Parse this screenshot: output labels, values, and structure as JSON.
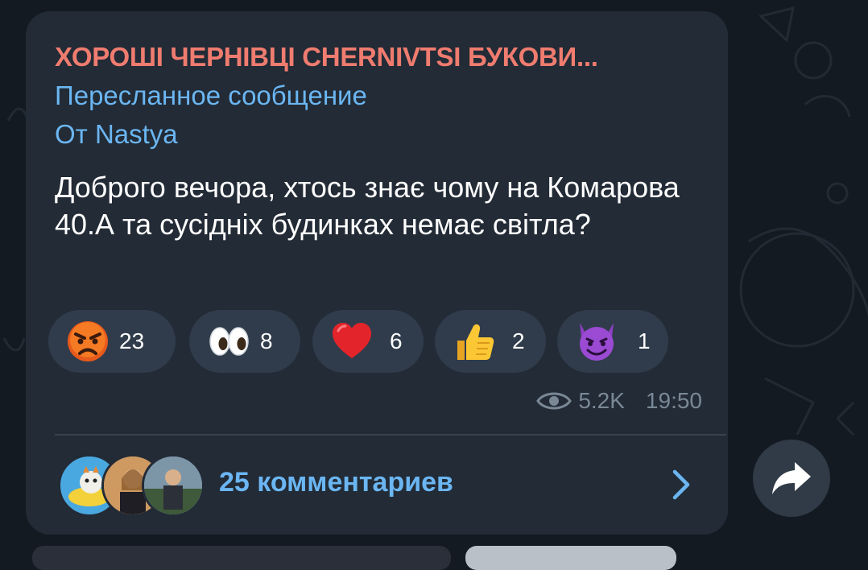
{
  "message": {
    "channel_title": "ХОРОШІ ЧЕРНІВЦІ CHERNIVTSI БУКОВИ...",
    "forwarded_label": "Пересланное сообщение",
    "forwarded_from": "От Nastya",
    "text": "Доброго вечора, хтось знає чому на Комарова 40.А та сусідніх будинках немає світла?",
    "reactions": [
      {
        "emoji": "angry-face-emoji",
        "count": "23"
      },
      {
        "emoji": "eyes-emoji",
        "count": "8"
      },
      {
        "emoji": "red-heart-emoji",
        "count": "6"
      },
      {
        "emoji": "thumbs-up-emoji",
        "count": "2"
      },
      {
        "emoji": "smiling-devil-emoji",
        "count": "1"
      }
    ],
    "views": "5.2K",
    "time": "19:50",
    "comments_label": "25 комментариев"
  },
  "colors": {
    "background": "#141a22",
    "bubble": "#222b36",
    "channel_title": "#ef7c6f",
    "link_blue": "#6bb6f2",
    "reaction_pill": "#303c4b",
    "meta_text": "#7a8896"
  },
  "icons": {
    "views": "eye-icon",
    "open_comments": "chevron-right-icon",
    "share": "share-arrow-icon"
  }
}
